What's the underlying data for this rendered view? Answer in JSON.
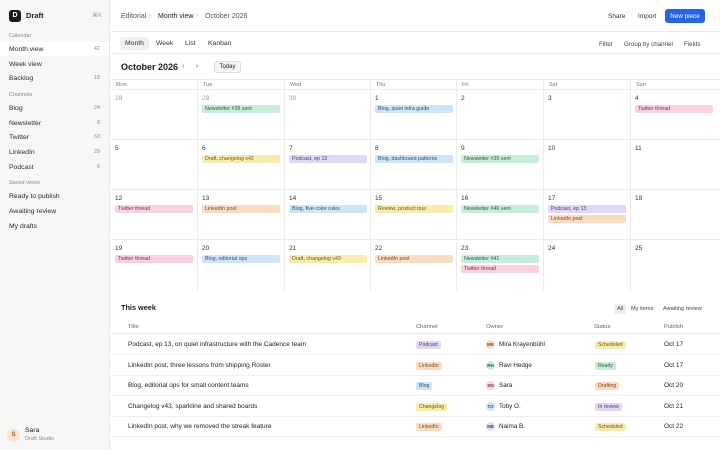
{
  "app": {
    "name": "Draft",
    "logo_letter": "D",
    "shortcut": "⌘K"
  },
  "sidebar": {
    "calendar_label": "Calendar",
    "calendar_items": [
      {
        "label": "Month view",
        "count": "42"
      },
      {
        "label": "Week view",
        "count": ""
      },
      {
        "label": "Backlog",
        "count": "18"
      }
    ],
    "channels_label": "Channels",
    "channels": [
      {
        "label": "Blog",
        "count": "24"
      },
      {
        "label": "Newsletter",
        "count": "8"
      },
      {
        "label": "Twitter",
        "count": "63"
      },
      {
        "label": "LinkedIn",
        "count": "29"
      },
      {
        "label": "Podcast",
        "count": "6"
      }
    ],
    "saved_label": "Saved views",
    "saved": [
      {
        "label": "Ready to publish"
      },
      {
        "label": "Awaiting review"
      },
      {
        "label": "My drafts"
      }
    ],
    "user": {
      "initial": "S",
      "name": "Sara",
      "org": "Draft Studio"
    }
  },
  "topbar": {
    "breadcrumb": [
      "Editorial",
      "Month view",
      "October 2026"
    ],
    "share": "Share",
    "import": "Import",
    "new_piece": "New piece"
  },
  "viewbar": {
    "tabs": [
      "Month",
      "Week",
      "List",
      "Kanban"
    ],
    "filter": "Filter",
    "group": "Group by channel",
    "fields": "Fields"
  },
  "calendar": {
    "title": "October 2026",
    "prev": "‹",
    "next": "›",
    "today": "Today",
    "dow": [
      "Mon",
      "Tue",
      "Wed",
      "Thu",
      "Fri",
      "Sat",
      "Sun"
    ],
    "weeks": [
      [
        {
          "day": "28",
          "muted": true,
          "events": []
        },
        {
          "day": "29",
          "muted": true,
          "events": [
            {
              "label": "Newsletter #38 sent",
              "color": "green"
            }
          ]
        },
        {
          "day": "30",
          "muted": true,
          "events": []
        },
        {
          "day": "1",
          "events": [
            {
              "label": "Blog, quiet infra guide",
              "color": "blue"
            }
          ]
        },
        {
          "day": "2",
          "events": []
        },
        {
          "day": "3",
          "events": []
        },
        {
          "day": "4",
          "events": [
            {
              "label": "Twitter thread",
              "color": "pink"
            }
          ]
        }
      ],
      [
        {
          "day": "5",
          "events": []
        },
        {
          "day": "6",
          "events": [
            {
              "label": "Draft, changelog v42",
              "color": "yellow"
            }
          ]
        },
        {
          "day": "7",
          "events": [
            {
              "label": "Podcast, ep 12",
              "color": "purple"
            }
          ]
        },
        {
          "day": "8",
          "events": [
            {
              "label": "Blog, dashboard patterns",
              "color": "blue"
            }
          ]
        },
        {
          "day": "9",
          "events": [
            {
              "label": "Newsletter #39 sent",
              "color": "green"
            }
          ]
        },
        {
          "day": "10",
          "events": []
        },
        {
          "day": "11",
          "events": []
        }
      ],
      [
        {
          "day": "12",
          "events": [
            {
              "label": "Twitter thread",
              "color": "pink"
            }
          ]
        },
        {
          "day": "13",
          "events": [
            {
              "label": "LinkedIn post",
              "color": "orange"
            }
          ]
        },
        {
          "day": "14",
          "events": [
            {
              "label": "Blog, five color rules",
              "color": "blue"
            }
          ]
        },
        {
          "day": "15",
          "events": [
            {
              "label": "Review, product tour",
              "color": "yellow"
            }
          ]
        },
        {
          "day": "16",
          "events": [
            {
              "label": "Newsletter #40 sent",
              "color": "green"
            }
          ]
        },
        {
          "day": "17",
          "events": [
            {
              "label": "Podcast, ep 13",
              "color": "purple"
            },
            {
              "label": "LinkedIn post",
              "color": "orange"
            }
          ]
        },
        {
          "day": "18",
          "events": []
        }
      ],
      [
        {
          "day": "19",
          "events": [
            {
              "label": "Twitter thread",
              "color": "pink"
            }
          ]
        },
        {
          "day": "20",
          "events": [
            {
              "label": "Blog, editorial ops",
              "color": "blue"
            }
          ]
        },
        {
          "day": "21",
          "events": [
            {
              "label": "Draft, changelog v43",
              "color": "yellow"
            }
          ]
        },
        {
          "day": "22",
          "events": [
            {
              "label": "LinkedIn post",
              "color": "orange"
            }
          ]
        },
        {
          "day": "23",
          "events": [
            {
              "label": "Newsletter #41",
              "color": "green"
            },
            {
              "label": "Twitter thread",
              "color": "pink"
            }
          ]
        },
        {
          "day": "24",
          "events": []
        },
        {
          "day": "25",
          "events": []
        }
      ]
    ]
  },
  "this_week": {
    "title": "This week",
    "filters": [
      "All",
      "My items",
      "Awaiting review"
    ],
    "columns": [
      "Title",
      "Channel",
      "Owner",
      "Status",
      "Publish"
    ],
    "rows": [
      {
        "title": "Podcast, ep 13, on quiet infrastructure with the Cadence team",
        "channel": "Podcast",
        "channel_color": "purple",
        "owner_initials": "MK",
        "owner": "Mira Krayenbühl",
        "owner_color": "orange",
        "status": "Scheduled",
        "status_key": "sched",
        "publish": "Oct 17"
      },
      {
        "title": "LinkedIn post, three lessons from shipping Roster",
        "channel": "LinkedIn",
        "channel_color": "orange",
        "owner_initials": "RH",
        "owner": "Ravi Hedge",
        "owner_color": "green",
        "status": "Ready",
        "status_key": "ready",
        "publish": "Oct 17"
      },
      {
        "title": "Blog, editorial ops for small content teams",
        "channel": "Blog",
        "channel_color": "blue",
        "owner_initials": "SN",
        "owner": "Sara",
        "owner_color": "pink",
        "status": "Drafting",
        "status_key": "draft",
        "publish": "Oct 20"
      },
      {
        "title": "Changelog v43, sparkline and shared boards",
        "channel": "Changelog",
        "channel_color": "yellow",
        "owner_initials": "TO",
        "owner": "Toby O.",
        "owner_color": "blue",
        "status": "In review",
        "status_key": "review",
        "publish": "Oct 21"
      },
      {
        "title": "LinkedIn post, why we removed the streak feature",
        "channel": "LinkedIn",
        "channel_color": "orange",
        "owner_initials": "NB",
        "owner": "Naima B.",
        "owner_color": "purple",
        "status": "Scheduled",
        "status_key": "sched",
        "publish": "Oct 22"
      }
    ]
  },
  "colors": {
    "accent": "#2563eb",
    "green": "#c9ecd8",
    "pink": "#fbd1dc",
    "blue": "#cfe4f6",
    "orange": "#fcdcc0",
    "yellow": "#f8ecad",
    "purple": "#e2d7f4"
  }
}
